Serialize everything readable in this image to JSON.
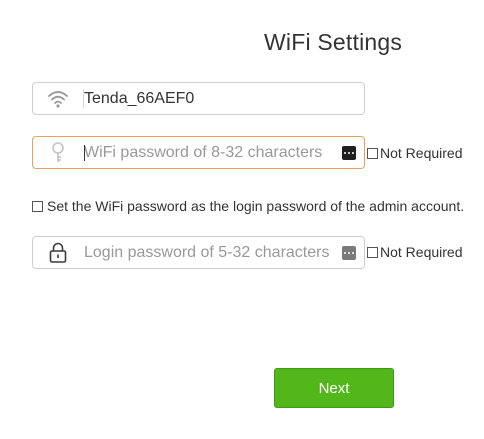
{
  "page": {
    "title": "WiFi Settings"
  },
  "ssid_field": {
    "value": "Tenda_66AEF0",
    "icon": "wifi-icon"
  },
  "wifi_password_field": {
    "placeholder": "WiFi password of 8-32 characters",
    "icon": "key-icon",
    "reveal_icon": "show-password-icon",
    "not_required_label": "Not Required"
  },
  "same_as_login": {
    "label": "Set the WiFi password as the login password of the admin account."
  },
  "login_password_field": {
    "placeholder": "Login password of 5-32 characters",
    "icon": "lock-icon",
    "reveal_icon": "show-password-icon",
    "not_required_label": "Not Required"
  },
  "actions": {
    "next_label": "Next"
  },
  "colors": {
    "accent_green": "#52b71a",
    "focus_border": "#e8a15e",
    "text": "#333333",
    "placeholder": "#999999"
  }
}
